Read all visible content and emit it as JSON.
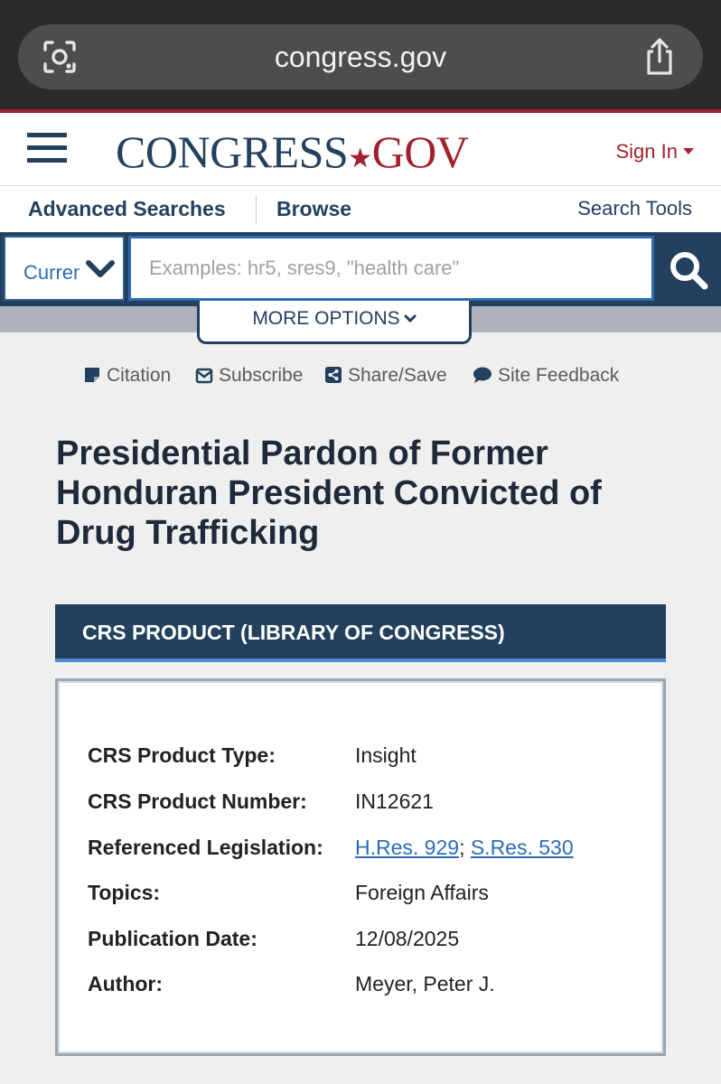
{
  "browser": {
    "url": "congress.gov"
  },
  "header": {
    "logo_main": "CONGRESS",
    "logo_dot": "★",
    "logo_gov": "GOV",
    "sign_in": "Sign In"
  },
  "nav": {
    "advanced_searches": "Advanced Searches",
    "browse": "Browse",
    "search_tools": "Search Tools"
  },
  "search": {
    "collection_value": "Current",
    "placeholder": "Examples: hr5, sres9, \"health care\"",
    "more_options": "MORE OPTIONS"
  },
  "utility": {
    "citation": "Citation",
    "subscribe": "Subscribe",
    "share_save": "Share/Save",
    "site_feedback": "Site Feedback"
  },
  "document": {
    "title": "Presidential Pardon of Former Honduran President Convicted of Drug Trafficking"
  },
  "crs": {
    "header": "CRS PRODUCT (LIBRARY OF CONGRESS)",
    "product_type_label": "CRS Product Type:",
    "product_type": "Insight",
    "product_number_label": "CRS Product Number:",
    "product_number": "IN12621",
    "legislation_label": "Referenced Legislation:",
    "legislation_1": "H.Res. 929",
    "legislation_sep": ";",
    "legislation_2": "S.Res. 530",
    "topics_label": "Topics:",
    "topics": "Foreign Affairs",
    "pub_date_label": "Publication Date:",
    "pub_date": "12/08/2025",
    "author_label": "Author:",
    "author": "Meyer, Peter J."
  },
  "colors": {
    "navy": "#23415f",
    "brand_red": "#a1222e",
    "link_blue": "#2d6db5"
  }
}
